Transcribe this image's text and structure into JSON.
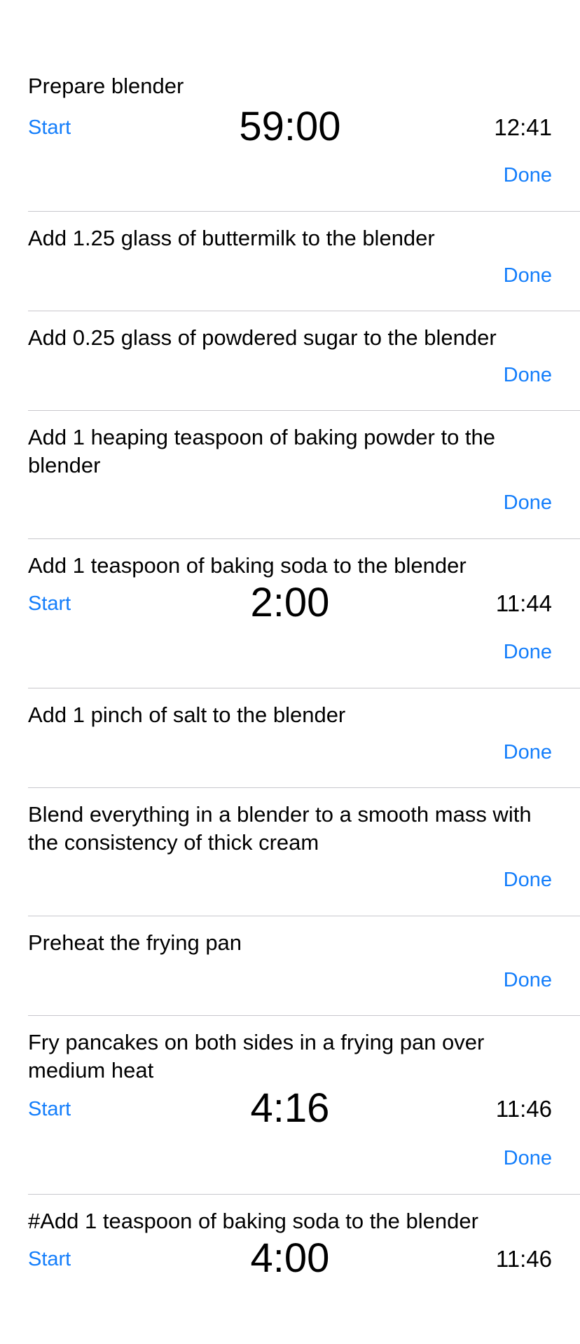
{
  "labels": {
    "start": "Start",
    "done": "Done"
  },
  "steps": [
    {
      "text": "Prepare blender",
      "timer": "59:00",
      "end_time": "12:41"
    },
    {
      "text": "Add 1.25 glass of buttermilk to the blender"
    },
    {
      "text": "Add 0.25 glass of powdered sugar to the blender"
    },
    {
      "text": "Add 1 heaping teaspoon of baking powder to the blender"
    },
    {
      "text": "Add 1 teaspoon of baking soda to the blender",
      "timer": "2:00",
      "end_time": "11:44"
    },
    {
      "text": "Add 1 pinch of salt to the blender"
    },
    {
      "text": "Blend everything in a blender to a smooth mass with the consistency of thick cream"
    },
    {
      "text": "Preheat the frying pan"
    },
    {
      "text": "Fry pancakes on both sides in a frying pan over medium heat",
      "timer": "4:16",
      "end_time": "11:46"
    },
    {
      "text": "#Add 1 teaspoon of baking soda to the blender",
      "timer": "4:00",
      "end_time": "11:46"
    }
  ],
  "colors": {
    "accent": "#147efb",
    "separator": "#c8c7cc",
    "text": "#000000"
  }
}
